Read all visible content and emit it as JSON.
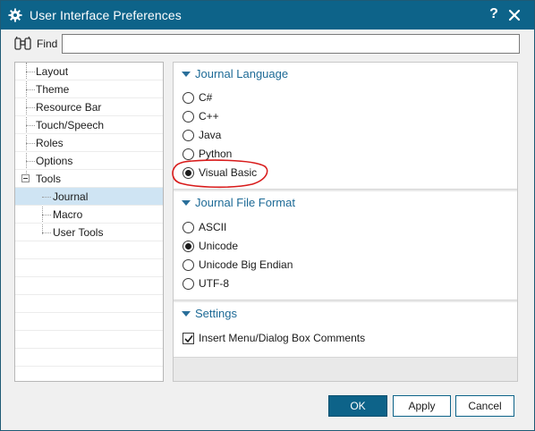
{
  "window": {
    "title": "User Interface Preferences",
    "help": "?",
    "title_bar_color": "#0d6389"
  },
  "find": {
    "label": "Find",
    "value": "",
    "placeholder": ""
  },
  "tree": {
    "items": [
      {
        "label": "Layout",
        "level": 1
      },
      {
        "label": "Theme",
        "level": 1
      },
      {
        "label": "Resource Bar",
        "level": 1
      },
      {
        "label": "Touch/Speech",
        "level": 1
      },
      {
        "label": "Roles",
        "level": 1
      },
      {
        "label": "Options",
        "level": 1
      },
      {
        "label": "Tools",
        "level": 1,
        "expanded": true
      },
      {
        "label": "Journal",
        "level": 2,
        "selected": true
      },
      {
        "label": "Macro",
        "level": 2
      },
      {
        "label": "User Tools",
        "level": 2
      }
    ]
  },
  "journal_language": {
    "title": "Journal Language",
    "options": [
      "C#",
      "C++",
      "Java",
      "Python",
      "Visual Basic"
    ],
    "selected": "Visual Basic"
  },
  "journal_file_format": {
    "title": "Journal File Format",
    "options": [
      "ASCII",
      "Unicode",
      "Unicode Big Endian",
      "UTF-8"
    ],
    "selected": "Unicode"
  },
  "settings": {
    "title": "Settings",
    "insert_comments_label": "Insert Menu/Dialog Box Comments",
    "insert_comments_checked": true
  },
  "buttons": {
    "ok": "OK",
    "apply": "Apply",
    "cancel": "Cancel"
  },
  "colors": {
    "accent": "#0d6389",
    "section_title": "#1d6a96",
    "annotation": "#d81b1b",
    "selection": "#cfe4f3"
  }
}
